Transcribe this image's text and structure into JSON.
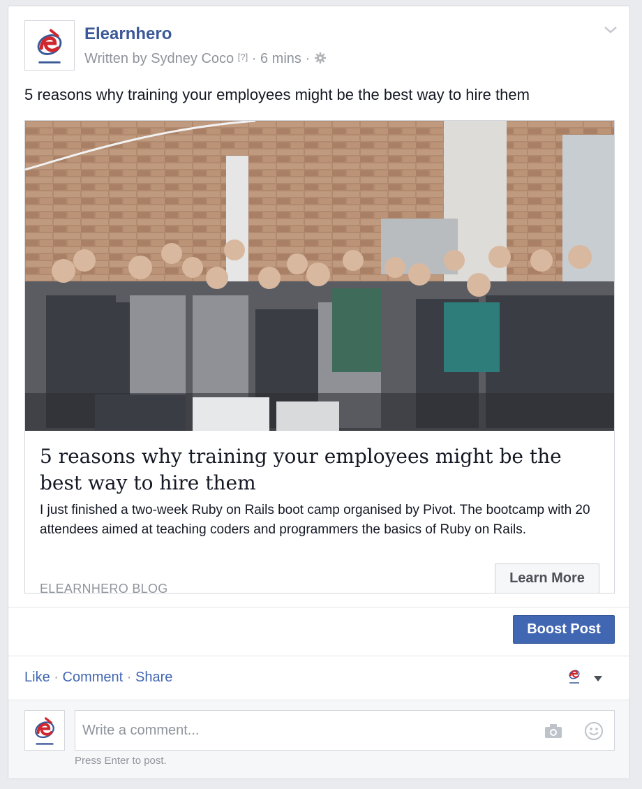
{
  "post": {
    "page_name": "Elearnhero",
    "author_line": "Written by Sydney Coco",
    "help_marker": "[?]",
    "separator": "·",
    "timestamp": "6 mins",
    "message": "5 reasons why training your employees might be the best way to hire them"
  },
  "link": {
    "title": "5 reasons why training your employees might be the best way to hire them",
    "description": "I just finished a two-week Ruby on Rails boot camp organised by Pivot. The bootcamp with 20 attendees aimed at teaching coders and programmers the basics of Ruby on Rails.",
    "domain": "ELEARNHERO BLOG",
    "cta_label": "Learn More"
  },
  "boost": {
    "label": "Boost Post"
  },
  "actions": {
    "like": "Like",
    "comment": "Comment",
    "share": "Share",
    "dot": "·"
  },
  "composer": {
    "placeholder": "Write a comment...",
    "hint": "Press Enter to post."
  },
  "icons": {
    "logo": "elearnhero-logo",
    "gear": "gear-icon",
    "chevron": "chevron-down-icon",
    "camera": "camera-icon",
    "emoji": "smiley-icon",
    "caret": "caret-down-icon"
  },
  "colors": {
    "brand_blue": "#3b5998",
    "button_blue": "#4267b2",
    "meta_gray": "#90949c",
    "logo_red": "#d0262d"
  }
}
